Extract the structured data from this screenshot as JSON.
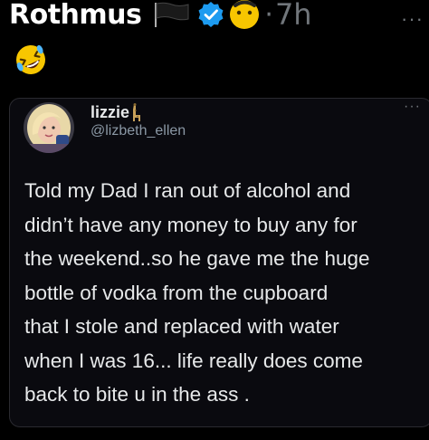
{
  "outer_tweet": {
    "author_name": "Rothmus",
    "separator": "·",
    "time": "7h",
    "more": "···",
    "icons": {
      "flag": "black-flag-icon",
      "verified": "verified-badge-icon",
      "emoji_after_name": "sun-face-emoji-icon",
      "body_emoji": "rolling-on-floor-laughing-emoji-icon"
    },
    "colors": {
      "verified_blue": "#1d9bf0",
      "muted_gray": "#71767b",
      "emoji_yellow": "#f7c600"
    }
  },
  "quoted_tweet": {
    "display_name": "lizzie",
    "handle": "@lizbeth_ellen",
    "more": "···",
    "name_emoji": "giraffe-emoji-icon",
    "text": "Told my Dad I ran out of alcohol and\ndidn’t have any money to buy any for\nthe weekend..so he gave me the huge\nbottle of vodka from the cupboard\nthat I stole and replaced with water\nwhen I was 16... life really does come\nback to bite u in the ass ."
  }
}
